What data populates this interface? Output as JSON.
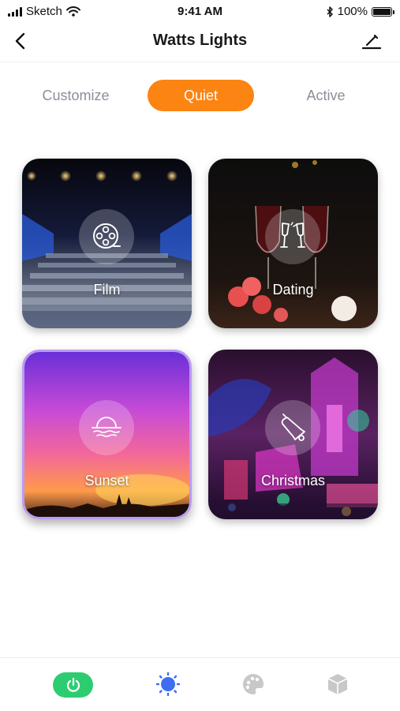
{
  "status_bar": {
    "carrier": "Sketch",
    "time": "9:41 AM",
    "battery": "100%",
    "icons": [
      "signal-icon",
      "wifi-icon",
      "bluetooth-icon",
      "battery-icon"
    ]
  },
  "nav": {
    "title": "Watts Lights",
    "back_icon": "chevron-left-icon",
    "edit_icon": "edit-icon"
  },
  "tabs": [
    {
      "label": "Customize",
      "selected": false
    },
    {
      "label": "Quiet",
      "selected": true
    },
    {
      "label": "Active",
      "selected": false
    }
  ],
  "scenes": [
    {
      "label": "Film",
      "icon": "film-reel-icon"
    },
    {
      "label": "Dating",
      "icon": "champagne-glasses-icon"
    },
    {
      "label": "Sunset",
      "icon": "sunset-icon",
      "selected": true
    },
    {
      "label": "Christmas",
      "icon": "bell-icon"
    }
  ],
  "bottom_nav": [
    {
      "icon": "power-icon",
      "active": true
    },
    {
      "icon": "sun-icon",
      "active": true
    },
    {
      "icon": "palette-icon",
      "active": false
    },
    {
      "icon": "cube-icon",
      "active": false
    }
  ],
  "colors": {
    "accent": "#fb8412",
    "power_green": "#2ecc71",
    "sun_blue": "#3f6df2",
    "inactive_icon": "#c8c8c8",
    "tab_inactive": "#8a8f98",
    "selected_border": "#b99cf2"
  }
}
